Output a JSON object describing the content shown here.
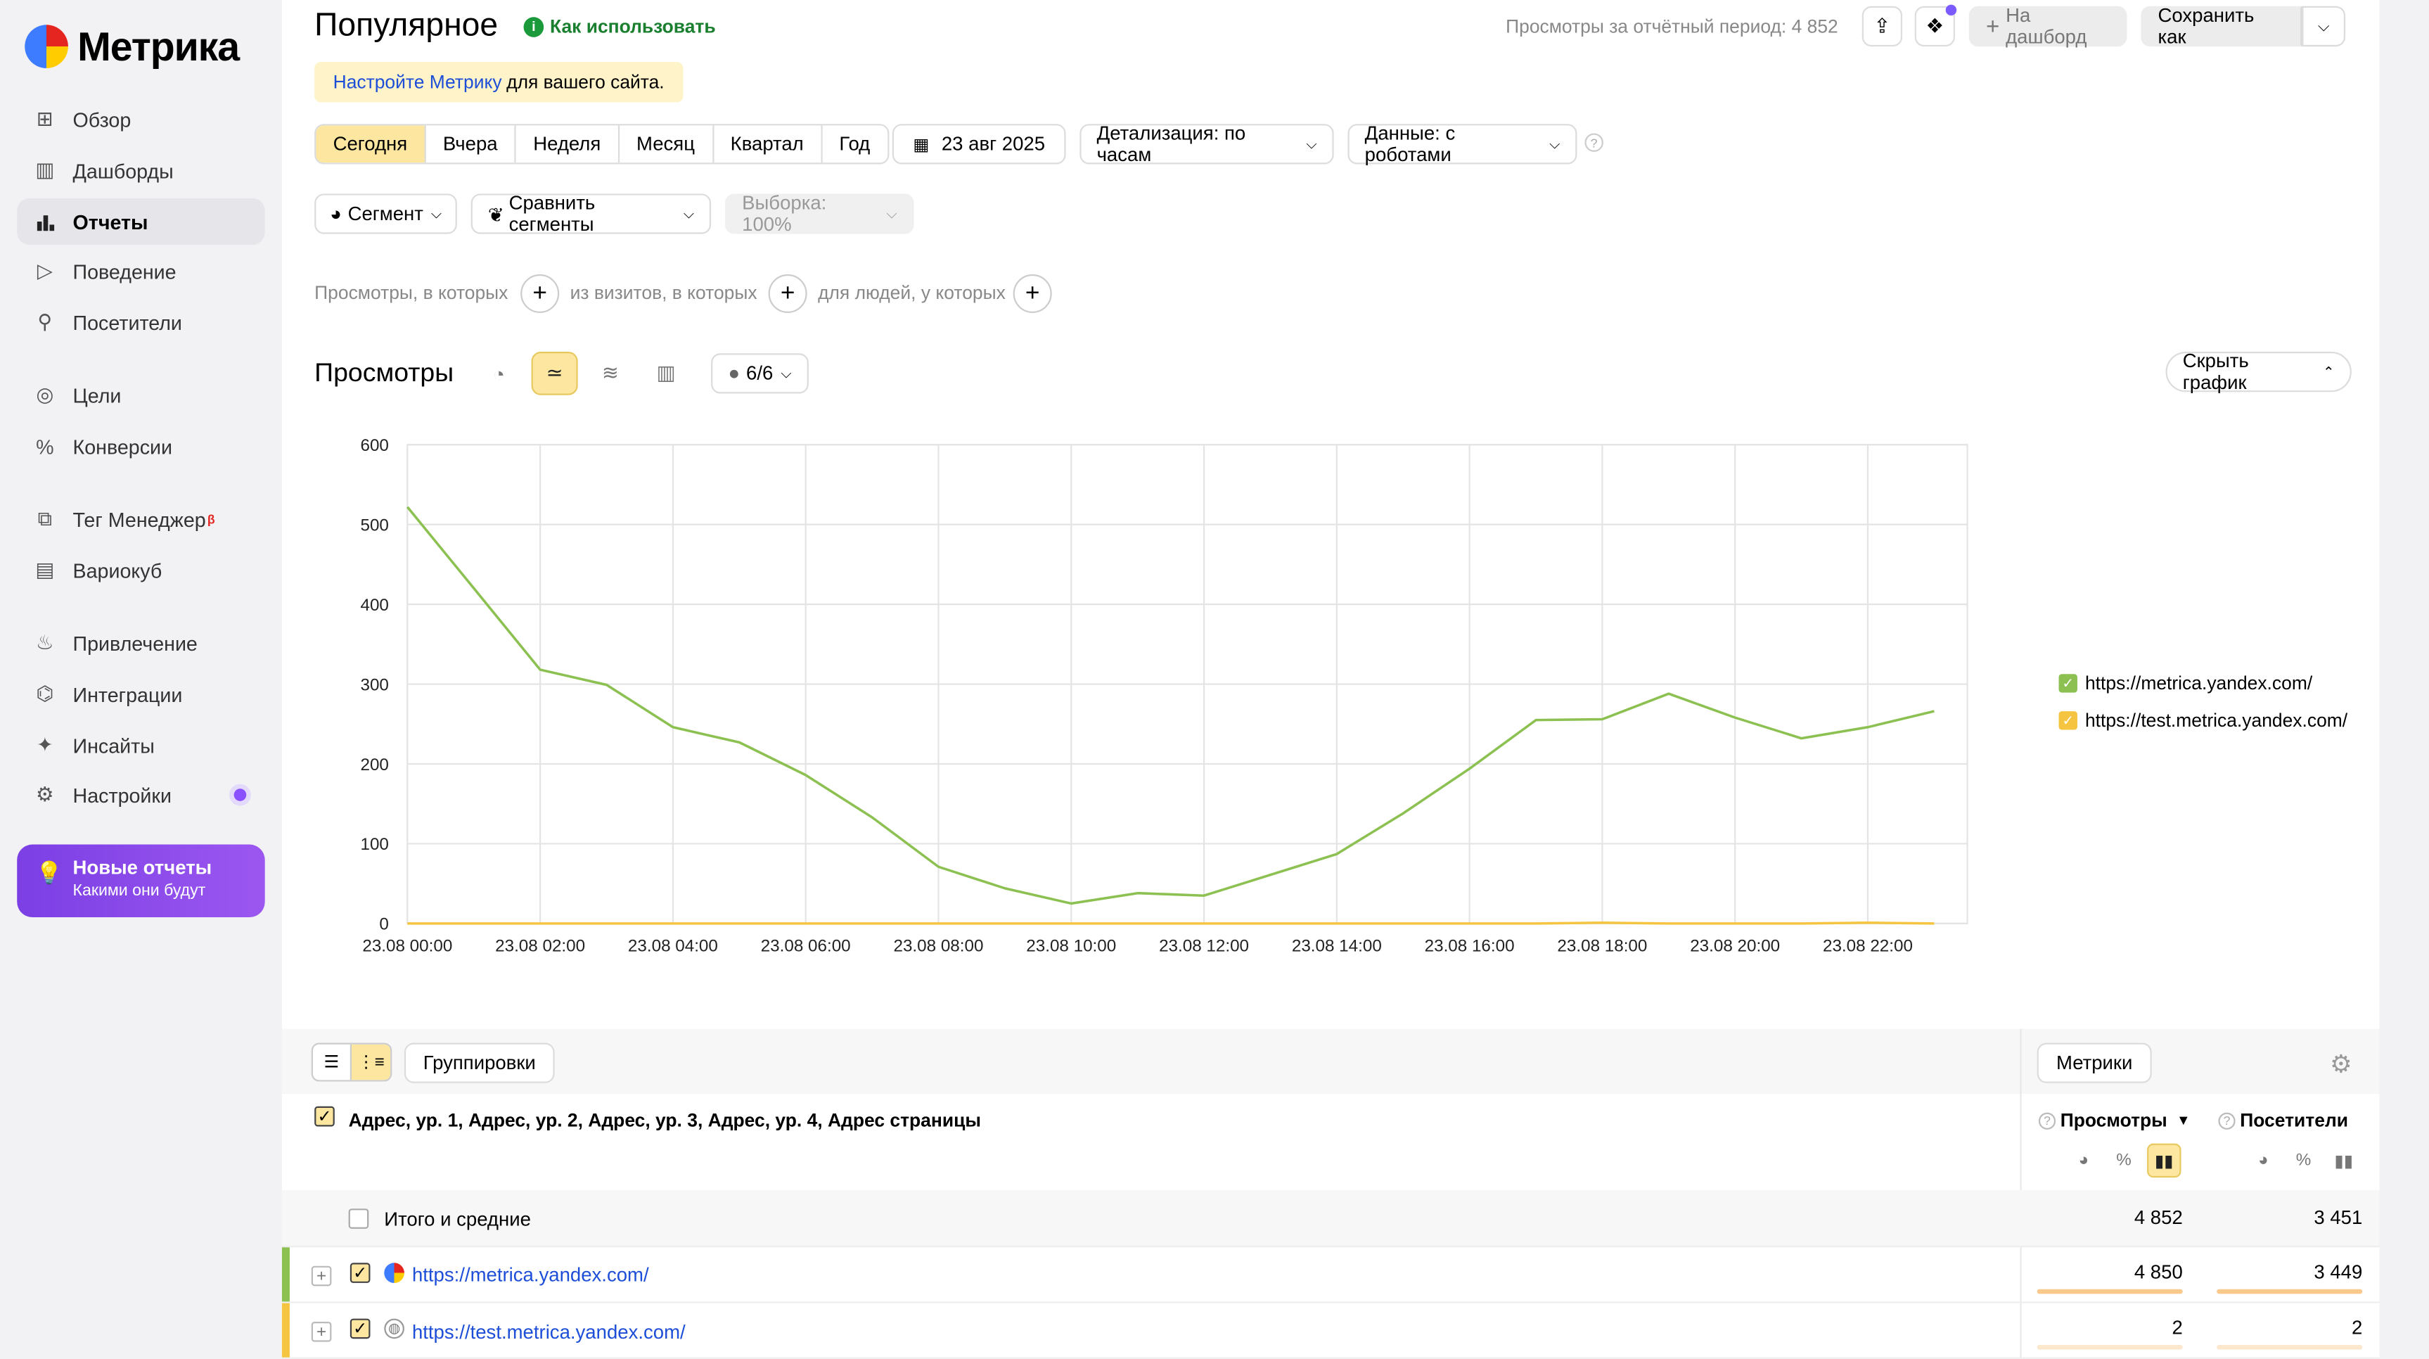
{
  "app": {
    "name": "Метрика"
  },
  "sidebar": {
    "items": [
      {
        "label": "Обзор",
        "icon": "overview-icon"
      },
      {
        "label": "Дашборды",
        "icon": "dashboards-icon"
      },
      {
        "label": "Отчеты",
        "icon": "reports-icon",
        "active": true
      },
      {
        "label": "Поведение",
        "icon": "play-icon"
      },
      {
        "label": "Посетители",
        "icon": "person-icon"
      },
      {
        "label": "Цели",
        "icon": "target-icon"
      },
      {
        "label": "Конверсии",
        "icon": "percent-icon"
      },
      {
        "label": "Тег Менеджер",
        "badge": "β",
        "icon": "tag-manager-icon"
      },
      {
        "label": "Вариокуб",
        "icon": "variocube-icon"
      },
      {
        "label": "Привлечение",
        "icon": "flame-icon"
      },
      {
        "label": "Интеграции",
        "icon": "puzzle-icon"
      },
      {
        "label": "Инсайты",
        "icon": "sparkle-icon"
      },
      {
        "label": "Настройки",
        "icon": "gear-icon"
      }
    ],
    "promo": {
      "title": "Новые отчеты",
      "subtitle": "Какими они будут"
    }
  },
  "header": {
    "title": "Популярное",
    "howto": "Как использовать",
    "views_total": "Просмотры за отчётный период: 4 852",
    "to_dashboard": "На дашборд",
    "save_as": "Сохранить как"
  },
  "notice": {
    "link": "Настройте Метрику",
    "text": "для вашего сайта."
  },
  "periods": [
    "Сегодня",
    "Вчера",
    "Неделя",
    "Месяц",
    "Квартал",
    "Год"
  ],
  "date": "23 авг 2025",
  "detail": "Детализация: по часам",
  "data_mode": "Данные: с роботами",
  "segment": "Сегмент",
  "compare": "Сравнить сегменты",
  "sample": "Выборка: 100%",
  "conditions": [
    "Просмотры, в которых",
    "из визитов, в которых",
    "для людей, у которых"
  ],
  "chart_panel": {
    "title": "Просмотры",
    "series_toggle": "6/6",
    "hide_chart": "Скрыть график"
  },
  "chart_data": {
    "type": "line",
    "x": [
      "23.08 00:00",
      "23.08 01:00",
      "23.08 02:00",
      "23.08 03:00",
      "23.08 04:00",
      "23.08 05:00",
      "23.08 06:00",
      "23.08 07:00",
      "23.08 08:00",
      "23.08 09:00",
      "23.08 10:00",
      "23.08 11:00",
      "23.08 12:00",
      "23.08 13:00",
      "23.08 14:00",
      "23.08 15:00",
      "23.08 16:00",
      "23.08 17:00",
      "23.08 18:00",
      "23.08 19:00",
      "23.08 20:00",
      "23.08 21:00",
      "23.08 22:00",
      "23.08 23:00"
    ],
    "x_tick_labels": [
      "23.08 00:00",
      "23.08 02:00",
      "23.08 04:00",
      "23.08 06:00",
      "23.08 08:00",
      "23.08 10:00",
      "23.08 12:00",
      "23.08 14:00",
      "23.08 16:00",
      "23.08 18:00",
      "23.08 20:00",
      "23.08 22:00"
    ],
    "y_ticks": [
      0,
      100,
      200,
      300,
      400,
      500,
      600
    ],
    "ylim": [
      0,
      600
    ],
    "grid": true,
    "legend_position": "right",
    "series": [
      {
        "name": "https://metrica.yandex.com/",
        "color": "#8cc152",
        "values": [
          522,
          420,
          318,
          299,
          246,
          227,
          186,
          133,
          71,
          44,
          25,
          38,
          35,
          61,
          87,
          138,
          194,
          255,
          256,
          288,
          258,
          232,
          246,
          266
        ]
      },
      {
        "name": "https://test.metrica.yandex.com/",
        "color": "#f5c542",
        "values": [
          0,
          0,
          0,
          0,
          0,
          0,
          0,
          0,
          0,
          0,
          0,
          0,
          0,
          0,
          0,
          0,
          0,
          0,
          1,
          0,
          0,
          0,
          1,
          0
        ]
      }
    ]
  },
  "table": {
    "view_toggle": [
      "list-icon",
      "tree-icon"
    ],
    "groupings": "Группировки",
    "metrics_button": "Метрики",
    "dimension_header": "Адрес, ур. 1, Адрес, ур. 2, Адрес, ур. 3, Адрес, ур. 4, Адрес страницы",
    "columns": [
      "Просмотры",
      "Посетители"
    ],
    "sort_arrow": "▼",
    "total": {
      "label": "Итого и средние",
      "values": [
        "4 852",
        "3 451"
      ]
    },
    "rows": [
      {
        "url": "https://metrica.yandex.com/",
        "values": [
          "4 850",
          "3 449"
        ],
        "color": "#8cc152",
        "bar_fractions": [
          1.0,
          1.0
        ]
      },
      {
        "url": "https://test.metrica.yandex.com/",
        "values": [
          "2",
          "2"
        ],
        "color": "#f5c542",
        "bar_fractions": [
          0.0004,
          0.0006
        ]
      }
    ]
  }
}
